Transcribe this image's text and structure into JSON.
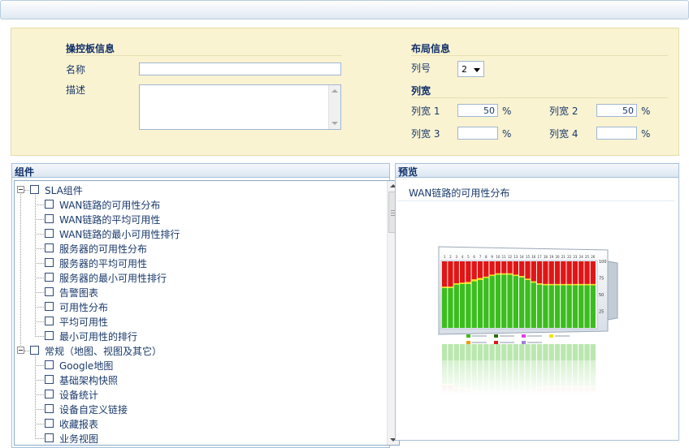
{
  "dashboard_info": {
    "title": "操控板信息",
    "name_label": "名称",
    "name_value": "",
    "desc_label": "描述",
    "desc_value": ""
  },
  "layout_info": {
    "title": "布局信息",
    "column_count_label": "列号",
    "column_count_value": "2",
    "width_title": "列宽",
    "width1_label": "列宽 1",
    "width1_value": "50",
    "width2_label": "列宽 2",
    "width2_value": "50",
    "width3_label": "列宽 3",
    "width3_value": "",
    "width4_label": "列宽 4",
    "width4_value": "",
    "percent": "%"
  },
  "components": {
    "title": "组件",
    "tree": [
      {
        "label": "SLA组件",
        "level": 0
      },
      {
        "label": "WAN链路的可用性分布",
        "level": 1
      },
      {
        "label": "WAN链路的平均可用性",
        "level": 1
      },
      {
        "label": "WAN链路的最小可用性排行",
        "level": 1
      },
      {
        "label": "服务器的可用性分布",
        "level": 1
      },
      {
        "label": "服务器的平均可用性",
        "level": 1
      },
      {
        "label": "服务器的最小可用性排行",
        "level": 1
      },
      {
        "label": "告警图表",
        "level": 1
      },
      {
        "label": "可用性分布",
        "level": 1
      },
      {
        "label": "平均可用性",
        "level": 1
      },
      {
        "label": "最小可用性的排行",
        "level": 1
      },
      {
        "label": "常规（地图、视图及其它）",
        "level": 0
      },
      {
        "label": "Google地图",
        "level": 1
      },
      {
        "label": "基础架构快照",
        "level": 1
      },
      {
        "label": "设备统计",
        "level": 1
      },
      {
        "label": "设备自定义链接",
        "level": 1
      },
      {
        "label": "收藏报表",
        "level": 1
      },
      {
        "label": "业务视图",
        "level": 1
      }
    ]
  },
  "preview": {
    "title": "预览",
    "widget_title": "WAN链路的可用性分布",
    "chart_data": {
      "type": "bar",
      "stacked": true,
      "categories": [
        "1",
        "2",
        "3",
        "4",
        "5",
        "6",
        "7",
        "8",
        "9",
        "10",
        "11",
        "12",
        "13",
        "14",
        "15",
        "16",
        "17",
        "18",
        "19",
        "20",
        "21",
        "22",
        "23",
        "24",
        "25",
        "26"
      ],
      "series": [
        {
          "color": "#3bbd1e",
          "values": [
            60,
            60,
            65,
            66,
            66,
            70,
            72,
            75,
            78,
            80,
            80,
            80,
            78,
            76,
            72,
            68,
            65,
            64,
            64,
            64,
            64,
            64,
            64,
            64,
            64,
            64
          ]
        },
        {
          "color": "#f3e10c",
          "values": [
            2,
            2,
            2,
            2,
            3,
            3,
            3,
            2,
            2,
            2,
            2,
            2,
            2,
            2,
            2,
            2,
            2,
            2,
            2,
            2,
            2,
            2,
            2,
            2,
            2,
            2
          ]
        },
        {
          "color": "#e01515",
          "values": [
            38,
            38,
            33,
            32,
            31,
            27,
            25,
            23,
            20,
            18,
            18,
            18,
            20,
            22,
            26,
            30,
            33,
            34,
            34,
            34,
            34,
            34,
            34,
            34,
            34,
            34
          ]
        }
      ],
      "ylim": [
        0,
        100
      ],
      "y_ticks": [
        "100",
        "75",
        "50",
        "25"
      ],
      "legend_colors": [
        "#3bbd1e",
        "#2e6b12",
        "#e040e0",
        "#f3e10c",
        "#f39a12",
        "#e01515",
        "#9b84d6"
      ]
    }
  }
}
